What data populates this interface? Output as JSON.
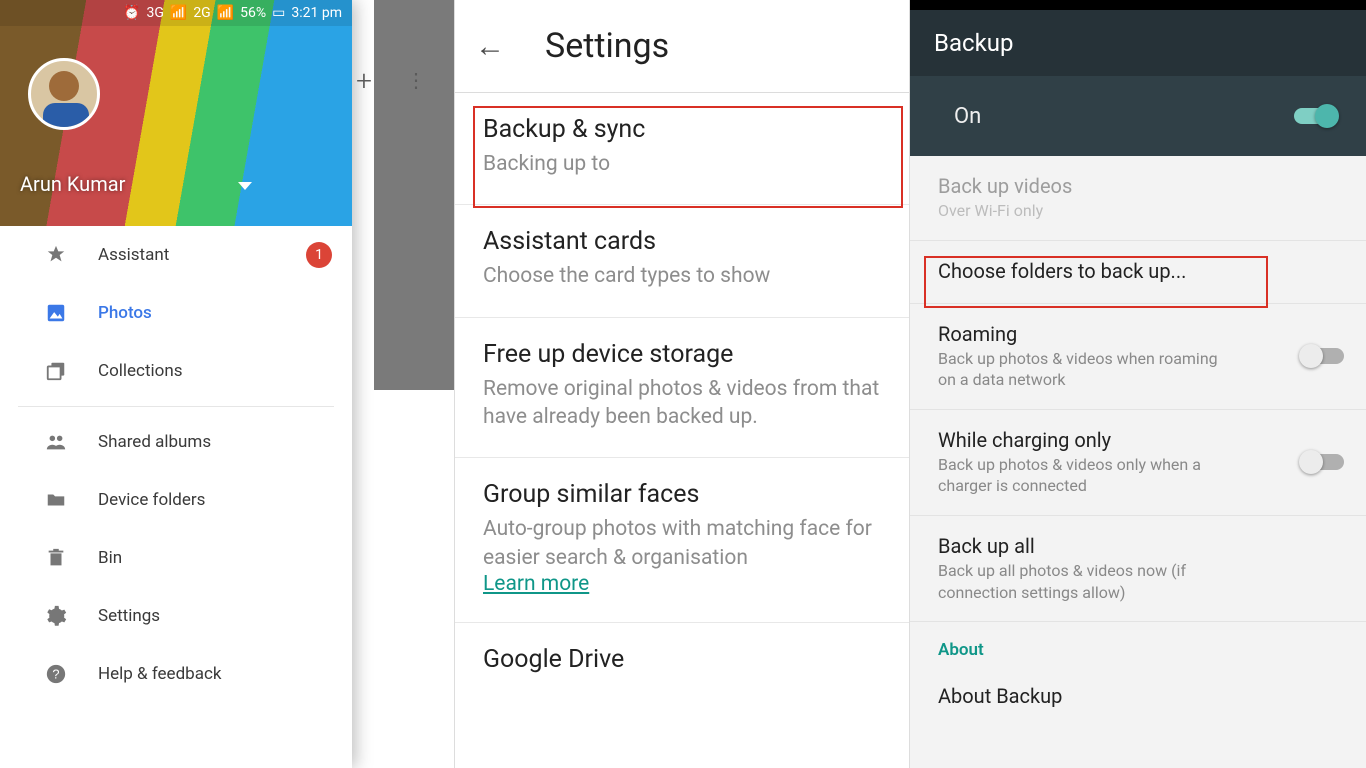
{
  "panel1": {
    "status": {
      "net1": "3G",
      "net2": "2G",
      "battery": "56%",
      "time": "3:21 pm"
    },
    "username": "Arun Kumar",
    "nav": {
      "assistant": "Assistant",
      "assistant_badge": "1",
      "photos": "Photos",
      "collections": "Collections",
      "shared_albums": "Shared albums",
      "device_folders": "Device folders",
      "bin": "Bin",
      "settings": "Settings",
      "help": "Help & feedback"
    }
  },
  "panel2": {
    "title": "Settings",
    "backup_sync": {
      "t": "Backup & sync",
      "s": "Backing up to"
    },
    "assistant_cards": {
      "t": "Assistant cards",
      "s": "Choose the card types to show"
    },
    "free_up": {
      "t": "Free up device storage",
      "s": "Remove original photos & videos from that have already been backed up."
    },
    "group_faces": {
      "t": "Group similar faces",
      "s": "Auto-group photos with matching face for easier search & organisation",
      "learn": "Learn more"
    },
    "google_drive": {
      "t": "Google Drive"
    }
  },
  "panel3": {
    "title": "Backup",
    "on_label": "On",
    "back_up_videos": {
      "t": "Back up videos",
      "s": "Over Wi-Fi only"
    },
    "choose_folders": "Choose folders to back up...",
    "roaming": {
      "t": "Roaming",
      "s": "Back up photos & videos when roaming on a data network"
    },
    "charging": {
      "t": "While charging only",
      "s": "Back up photos & videos only when a charger is connected"
    },
    "backup_all": {
      "t": "Back up all",
      "s": "Back up all photos & videos now (if connection settings allow)"
    },
    "about_section": "About",
    "about_backup": "About Backup"
  }
}
